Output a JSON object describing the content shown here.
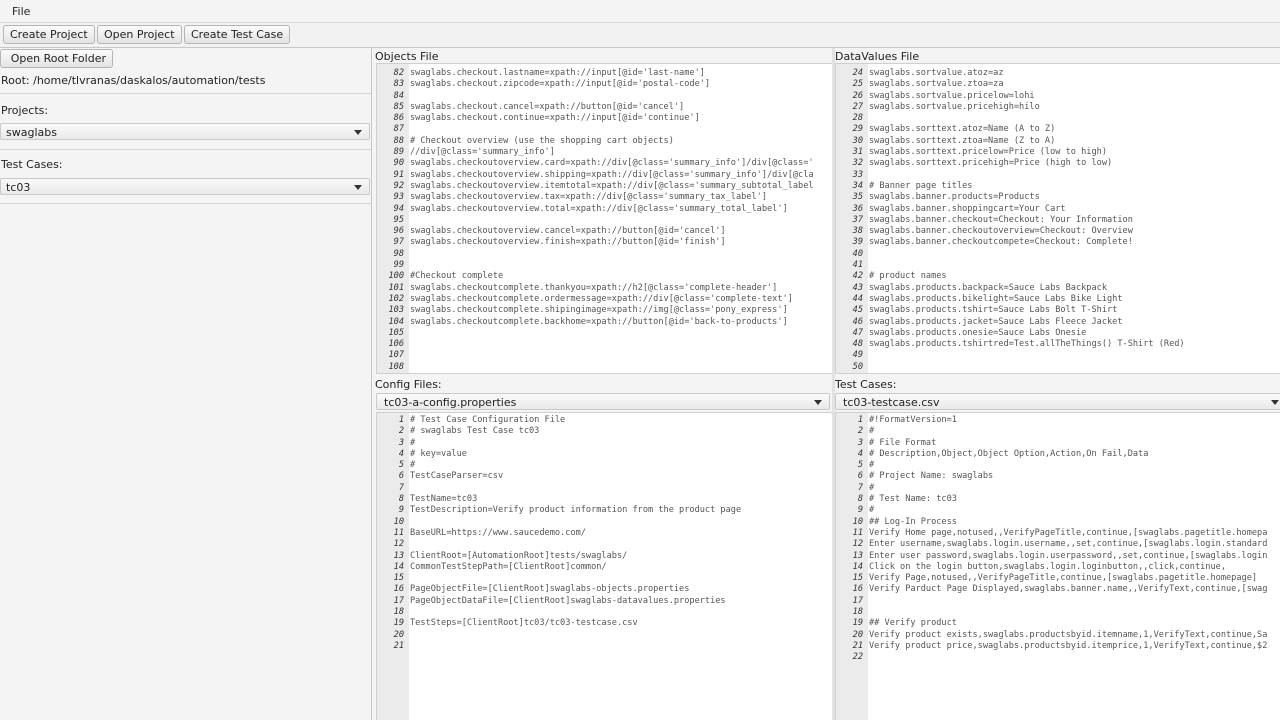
{
  "menubar": {
    "file": "File"
  },
  "toolbar": {
    "create_project": "Create Project",
    "open_project": "Open Project",
    "create_test_case": "Create Test Case"
  },
  "sidebar": {
    "open_root_folder": "Open Root Folder",
    "root_path": "Root: /home/tlvranas/daskalos/automation/tests",
    "projects_label": "Projects:",
    "project_selected": "swaglabs",
    "test_cases_label": "Test Cases:",
    "test_case_selected": "tc03"
  },
  "objects_file": {
    "title": "Objects File",
    "lines": [
      {
        "n": "82",
        "t": "swaglabs.checkout.lastname=xpath://input[@id='last-name']"
      },
      {
        "n": "83",
        "t": "swaglabs.checkout.zipcode=xpath://input[@id='postal-code']"
      },
      {
        "n": "84",
        "t": ""
      },
      {
        "n": "85",
        "t": "swaglabs.checkout.cancel=xpath://button[@id='cancel']"
      },
      {
        "n": "86",
        "t": "swaglabs.checkout.continue=xpath://input[@id='continue']"
      },
      {
        "n": "87",
        "t": ""
      },
      {
        "n": "88",
        "t": "# Checkout overview (use the shopping cart objects)"
      },
      {
        "n": "89",
        "t": "//div[@class='summary_info']"
      },
      {
        "n": "90",
        "t": "swaglabs.checkoutoverview.card=xpath://div[@class='summary_info']/div[@class='"
      },
      {
        "n": "91",
        "t": "swaglabs.checkoutoverview.shipping=xpath://div[@class='summary_info']/div[@cla"
      },
      {
        "n": "92",
        "t": "swaglabs.checkoutoverview.itemtotal=xpath://div[@class='summary_subtotal_label"
      },
      {
        "n": "93",
        "t": "swaglabs.checkoutoverview.tax=xpath://div[@class='summary_tax_label']"
      },
      {
        "n": "94",
        "t": "swaglabs.checkoutoverview.total=xpath://div[@class='summary_total_label']"
      },
      {
        "n": "95",
        "t": ""
      },
      {
        "n": "96",
        "t": "swaglabs.checkoutoverview.cancel=xpath://button[@id='cancel']"
      },
      {
        "n": "97",
        "t": "swaglabs.checkoutoverview.finish=xpath://button[@id='finish']"
      },
      {
        "n": "98",
        "t": ""
      },
      {
        "n": "99",
        "t": ""
      },
      {
        "n": "100",
        "t": "#Checkout complete"
      },
      {
        "n": "101",
        "t": "swaglabs.checkoutcomplete.thankyou=xpath://h2[@class='complete-header']"
      },
      {
        "n": "102",
        "t": "swaglabs.checkoutcomplete.ordermessage=xpath://div[@class='complete-text']"
      },
      {
        "n": "103",
        "t": "swaglabs.checkoutcomplete.shipingimage=xpath://img[@class='pony_express']"
      },
      {
        "n": "104",
        "t": "swaglabs.checkoutcomplete.backhome=xpath://button[@id='back-to-products']"
      },
      {
        "n": "105",
        "t": ""
      },
      {
        "n": "106",
        "t": ""
      },
      {
        "n": "107",
        "t": ""
      },
      {
        "n": "108",
        "t": ""
      }
    ]
  },
  "datavalues_file": {
    "title": "DataValues File",
    "lines": [
      {
        "n": "24",
        "t": "swaglabs.sortvalue.atoz=az"
      },
      {
        "n": "25",
        "t": "swaglabs.sortvalue.ztoa=za"
      },
      {
        "n": "26",
        "t": "swaglabs.sortvalue.pricelow=lohi"
      },
      {
        "n": "27",
        "t": "swaglabs.sortvalue.pricehigh=hilo"
      },
      {
        "n": "28",
        "t": ""
      },
      {
        "n": "29",
        "t": "swaglabs.sorttext.atoz=Name (A to Z)"
      },
      {
        "n": "30",
        "t": "swaglabs.sorttext.ztoa=Name (Z to A)"
      },
      {
        "n": "31",
        "t": "swaglabs.sorttext.pricelow=Price (low to high)"
      },
      {
        "n": "32",
        "t": "swaglabs.sorttext.pricehigh=Price (high to low)"
      },
      {
        "n": "33",
        "t": ""
      },
      {
        "n": "34",
        "t": "# Banner page titles"
      },
      {
        "n": "35",
        "t": "swaglabs.banner.products=Products"
      },
      {
        "n": "36",
        "t": "swaglabs.banner.shoppingcart=Your Cart"
      },
      {
        "n": "37",
        "t": "swaglabs.banner.checkout=Checkout: Your Information"
      },
      {
        "n": "38",
        "t": "swaglabs.banner.checkoutoverview=Checkout: Overview"
      },
      {
        "n": "39",
        "t": "swaglabs.banner.checkoutcompete=Checkout: Complete!"
      },
      {
        "n": "40",
        "t": ""
      },
      {
        "n": "41",
        "t": ""
      },
      {
        "n": "42",
        "t": "# product names"
      },
      {
        "n": "43",
        "t": "swaglabs.products.backpack=Sauce Labs Backpack"
      },
      {
        "n": "44",
        "t": "swaglabs.products.bikelight=Sauce Labs Bike Light"
      },
      {
        "n": "45",
        "t": "swaglabs.products.tshirt=Sauce Labs Bolt T-Shirt"
      },
      {
        "n": "46",
        "t": "swaglabs.products.jacket=Sauce Labs Fleece Jacket"
      },
      {
        "n": "47",
        "t": "swaglabs.products.onesie=Sauce Labs Onesie"
      },
      {
        "n": "48",
        "t": "swaglabs.products.tshirtred=Test.allTheThings() T-Shirt (Red)"
      },
      {
        "n": "49",
        "t": ""
      },
      {
        "n": "50",
        "t": ""
      }
    ]
  },
  "config_files": {
    "title": "Config Files:",
    "selected": "tc03-a-config.properties",
    "lines": [
      {
        "n": "1",
        "t": "# Test Case Configuration File"
      },
      {
        "n": "2",
        "t": "# swaglabs Test Case tc03"
      },
      {
        "n": "3",
        "t": "#"
      },
      {
        "n": "4",
        "t": "# key=value"
      },
      {
        "n": "5",
        "t": "#"
      },
      {
        "n": "6",
        "t": "TestCaseParser=csv"
      },
      {
        "n": "7",
        "t": ""
      },
      {
        "n": "8",
        "t": "TestName=tc03"
      },
      {
        "n": "9",
        "t": "TestDescription=Verify product information from the product page"
      },
      {
        "n": "10",
        "t": ""
      },
      {
        "n": "11",
        "t": "BaseURL=https://www.saucedemo.com/"
      },
      {
        "n": "12",
        "t": ""
      },
      {
        "n": "13",
        "t": "ClientRoot=[AutomationRoot]tests/swaglabs/"
      },
      {
        "n": "14",
        "t": "CommonTestStepPath=[ClientRoot]common/"
      },
      {
        "n": "15",
        "t": ""
      },
      {
        "n": "16",
        "t": "PageObjectFile=[ClientRoot]swaglabs-objects.properties"
      },
      {
        "n": "17",
        "t": "PageObjectDataFile=[ClientRoot]swaglabs-datavalues.properties"
      },
      {
        "n": "18",
        "t": ""
      },
      {
        "n": "19",
        "t": "TestSteps=[ClientRoot]tc03/tc03-testcase.csv"
      },
      {
        "n": "20",
        "t": ""
      },
      {
        "n": "21",
        "t": ""
      }
    ]
  },
  "test_cases": {
    "title": "Test Cases:",
    "selected": "tc03-testcase.csv",
    "lines": [
      {
        "n": "1",
        "t": "#!FormatVersion=1"
      },
      {
        "n": "2",
        "t": "#"
      },
      {
        "n": "3",
        "t": "# File Format"
      },
      {
        "n": "4",
        "t": "# Description,Object,Object Option,Action,On Fail,Data"
      },
      {
        "n": "5",
        "t": "#"
      },
      {
        "n": "6",
        "t": "# Project Name: swaglabs"
      },
      {
        "n": "7",
        "t": "#"
      },
      {
        "n": "8",
        "t": "# Test Name: tc03"
      },
      {
        "n": "9",
        "t": "#"
      },
      {
        "n": "10",
        "t": "## Log-In Process"
      },
      {
        "n": "11",
        "t": "Verify Home page,notused,,VerifyPageTitle,continue,[swaglabs.pagetitle.homepa"
      },
      {
        "n": "12",
        "t": "Enter username,swaglabs.login.username,,set,continue,[swaglabs.login.standard"
      },
      {
        "n": "13",
        "t": "Enter user password,swaglabs.login.userpassword,,set,continue,[swaglabs.login"
      },
      {
        "n": "14",
        "t": "Click on the login button,swaglabs.login.loginbutton,,click,continue,"
      },
      {
        "n": "15",
        "t": "Verify Page,notused,,VerifyPageTitle,continue,[swaglabs.pagetitle.homepage]"
      },
      {
        "n": "16",
        "t": "Verify Parduct Page Displayed,swaglabs.banner.name,,VerifyText,continue,[swag"
      },
      {
        "n": "17",
        "t": ""
      },
      {
        "n": "18",
        "t": ""
      },
      {
        "n": "19",
        "t": "## Verify product"
      },
      {
        "n": "20",
        "t": "Verify product exists,swaglabs.productsbyid.itemname,1,VerifyText,continue,Sa"
      },
      {
        "n": "21",
        "t": "Verify product price,swaglabs.productsbyid.itemprice,1,VerifyText,continue,$2"
      },
      {
        "n": "22",
        "t": ""
      }
    ]
  }
}
